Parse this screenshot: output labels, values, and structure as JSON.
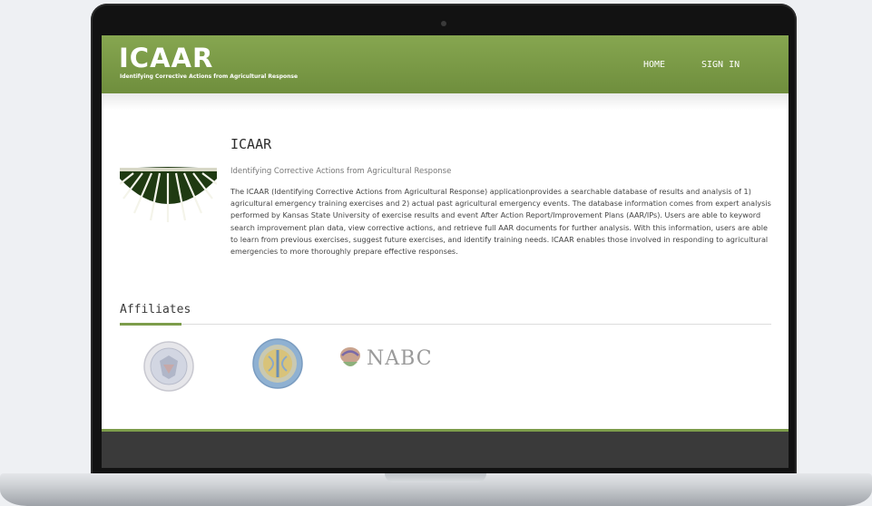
{
  "header": {
    "logo": "ICAAR",
    "logo_subtitle": "Identifying Corrective Actions from Agricultural Response",
    "nav": {
      "home": "HOME",
      "sign_in": "SIGN IN"
    },
    "color": "#7d9d4b"
  },
  "main": {
    "title": "ICAAR",
    "subtitle": "Identifying Corrective Actions from Agricultural Response",
    "description": "The ICAAR (Identifying Corrective Actions from Agricultural Response) applicationprovides a searchable database of results and analysis of 1) agricultural emergency training exercises and 2) actual past agricultural emergency events. The database information comes from expert analysis performed by Kansas State University of exercise results and event After Action Report/Improvement Plans (AAR/IPs). Users are able to keyword search improvement plan data, view corrective actions, and retrieve full AAR documents for further analysis. With this information, users are able to learn from previous exercises, suggest future exercises, and identify training needs. ICAAR enables those involved in responding to agricultural emergencies to more thoroughly prepare effective responses.",
    "hero_icon": "field-rows-image"
  },
  "affiliates": {
    "title": "Affiliates",
    "logos": [
      {
        "icon": "dhs-seal-icon"
      },
      {
        "icon": "usda-seal-icon"
      },
      {
        "icon": "nabc-logo-icon",
        "text": "NABC"
      }
    ]
  }
}
